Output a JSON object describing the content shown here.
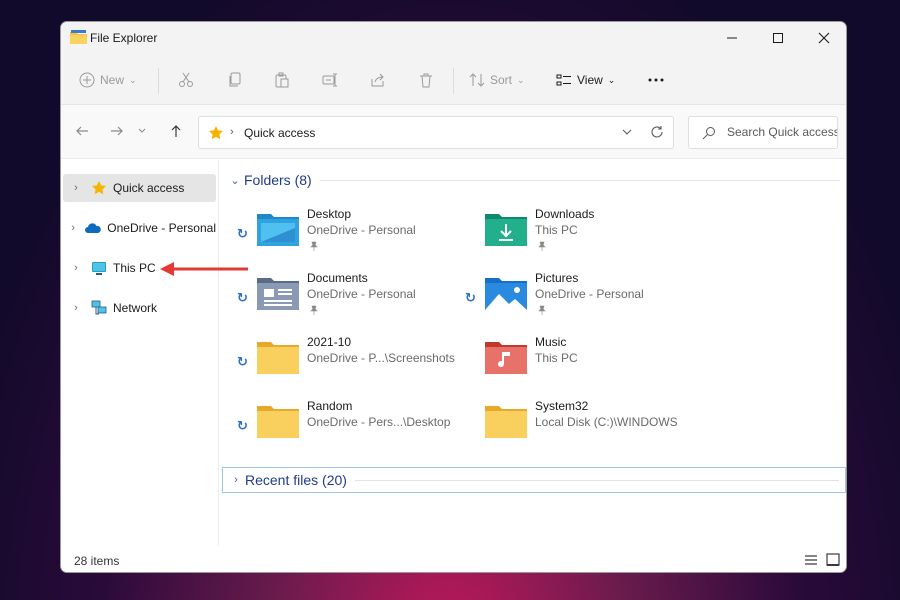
{
  "window": {
    "title": "File Explorer"
  },
  "toolbar": {
    "new_label": "New",
    "sort_label": "Sort",
    "view_label": "View"
  },
  "address": {
    "path": "Quick access"
  },
  "search": {
    "placeholder": "Search Quick access"
  },
  "sidebar": {
    "items": [
      {
        "label": "Quick access",
        "selected": true,
        "icon": "star-icon"
      },
      {
        "label": "OneDrive - Personal",
        "icon": "cloud-icon"
      },
      {
        "label": "This PC",
        "icon": "monitor-icon"
      },
      {
        "label": "Network",
        "icon": "network-icon"
      }
    ]
  },
  "main": {
    "folders_header": "Folders (8)",
    "recent_header": "Recent files (20)",
    "folders": [
      {
        "name": "Desktop",
        "location": "OneDrive - Personal",
        "icon": "desktop-folder-icon",
        "synced": true,
        "pinned": true
      },
      {
        "name": "Downloads",
        "location": "This PC",
        "icon": "downloads-folder-icon",
        "synced": false,
        "pinned": true
      },
      {
        "name": "Documents",
        "location": "OneDrive - Personal",
        "icon": "documents-folder-icon",
        "synced": true,
        "pinned": true
      },
      {
        "name": "Pictures",
        "location": "OneDrive - Personal",
        "icon": "pictures-folder-icon",
        "synced": true,
        "pinned": true
      },
      {
        "name": "2021-10",
        "location": "OneDrive - P...\\Screenshots",
        "icon": "folder-icon",
        "synced": true,
        "pinned": false
      },
      {
        "name": "Music",
        "location": "This PC",
        "icon": "music-folder-icon",
        "synced": false,
        "pinned": false
      },
      {
        "name": "Random",
        "location": "OneDrive - Pers...\\Desktop",
        "icon": "folder-icon",
        "synced": true,
        "pinned": false
      },
      {
        "name": "System32",
        "location": "Local Disk (C:)\\WINDOWS",
        "icon": "folder-icon",
        "synced": false,
        "pinned": false
      }
    ]
  },
  "status": {
    "item_count": "28 items"
  },
  "colors": {
    "accent": "#0067c0",
    "folder_yellow": "#f5c242",
    "arrow_red": "#e53935"
  }
}
